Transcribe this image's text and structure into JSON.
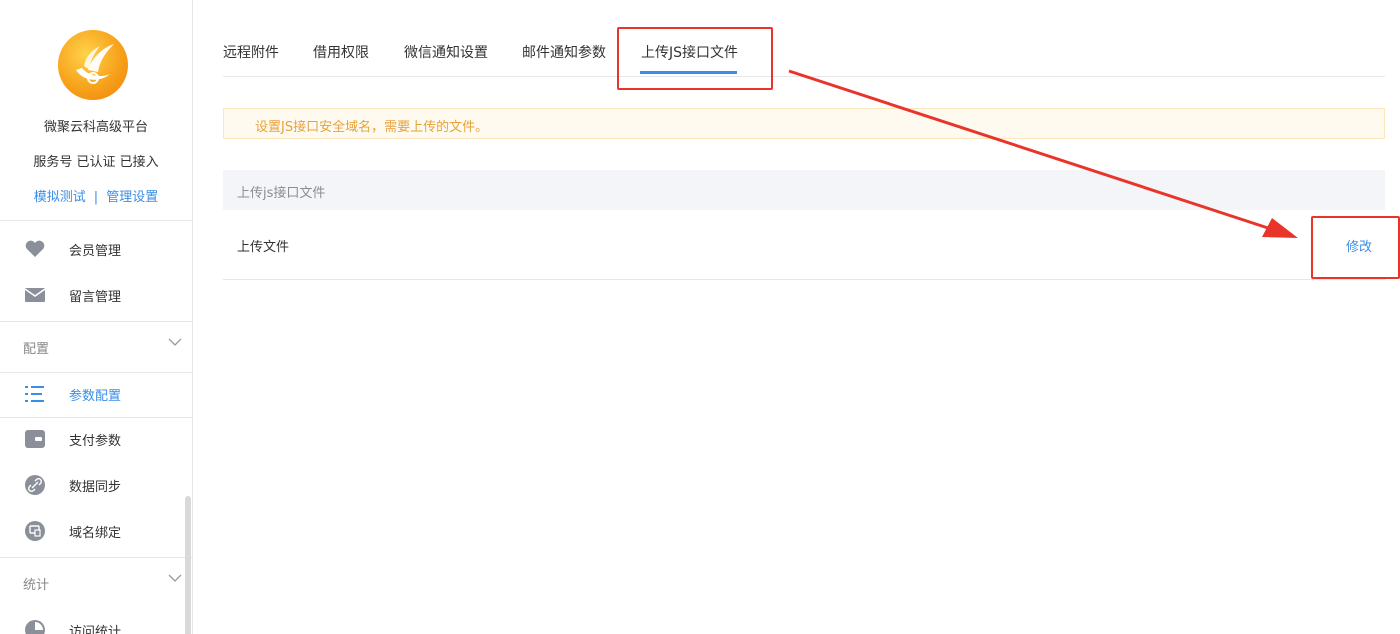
{
  "sidebar": {
    "platform_name": "微聚云科高级平台",
    "account_status": "服务号 已认证 已接入",
    "links": {
      "simulate": "模拟测试",
      "separator": "|",
      "manage": "管理设置"
    },
    "items_top": [
      {
        "label": "会员管理",
        "icon": "heart-icon"
      },
      {
        "label": "留言管理",
        "icon": "mail-icon"
      }
    ],
    "section_config": "配置",
    "items_config": [
      {
        "label": "参数配置",
        "icon": "list-settings-icon",
        "active": true
      },
      {
        "label": "支付参数",
        "icon": "wallet-icon"
      },
      {
        "label": "数据同步",
        "icon": "link-icon"
      },
      {
        "label": "域名绑定",
        "icon": "domain-icon"
      }
    ],
    "section_stats": "统计",
    "items_stats": [
      {
        "label": "访问统计",
        "icon": "chart-icon"
      }
    ]
  },
  "tabs": [
    {
      "label": "远程附件"
    },
    {
      "label": "借用权限"
    },
    {
      "label": "微信通知设置"
    },
    {
      "label": "邮件通知参数"
    },
    {
      "label": "上传JS接口文件",
      "active": true
    }
  ],
  "notice": "设置JS接口安全域名，需要上传的文件。",
  "table": {
    "header": "上传js接口文件",
    "row_label": "上传文件",
    "row_action": "修改"
  },
  "colors": {
    "accent": "#3a8ee6",
    "annotation": "#e9342a",
    "notice_text": "#e6a23c"
  }
}
